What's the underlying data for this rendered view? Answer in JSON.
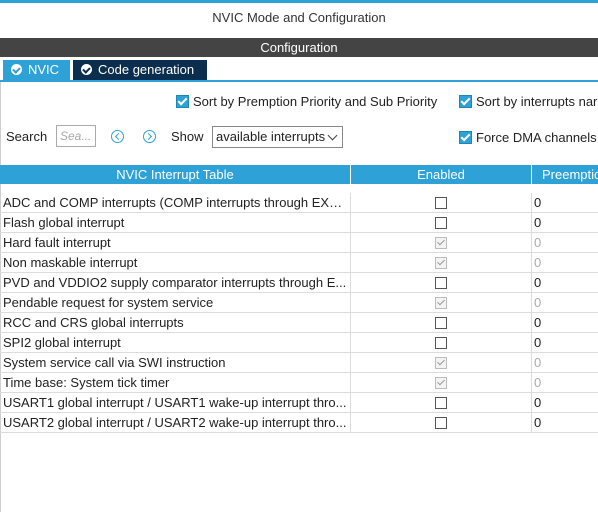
{
  "window": {
    "title": "NVIC Mode and Configuration"
  },
  "configuration_bar": "Configuration",
  "tabs": [
    {
      "label": "NVIC",
      "active": true
    },
    {
      "label": "Code generation",
      "active": false
    }
  ],
  "options": {
    "sort_premption": {
      "label": "Sort by Premption Priority and Sub Priority",
      "checked": true
    },
    "sort_interrupts": {
      "label": "Sort by interrupts nar",
      "checked": true
    },
    "force_dma": {
      "label": "Force DMA channels",
      "checked": true
    }
  },
  "search": {
    "label": "Search",
    "placeholder": "Sea..."
  },
  "show": {
    "label": "Show",
    "selected": "available interrupts"
  },
  "table": {
    "headers": [
      "NVIC Interrupt Table",
      "Enabled",
      "Preemptio"
    ],
    "rows": [
      {
        "name": "ADC and COMP interrupts (COMP interrupts through EXTI...",
        "enabled": false,
        "disabled": false,
        "preemption": "0"
      },
      {
        "name": "Flash global interrupt",
        "enabled": false,
        "disabled": false,
        "preemption": "0"
      },
      {
        "name": "Hard fault interrupt",
        "enabled": true,
        "disabled": true,
        "preemption": "0"
      },
      {
        "name": "Non maskable interrupt",
        "enabled": true,
        "disabled": true,
        "preemption": "0"
      },
      {
        "name": "PVD and VDDIO2 supply comparator interrupts through E...",
        "enabled": false,
        "disabled": false,
        "preemption": "0"
      },
      {
        "name": "Pendable request for system service",
        "enabled": true,
        "disabled": true,
        "preemption": "0"
      },
      {
        "name": "RCC and CRS global interrupts",
        "enabled": false,
        "disabled": false,
        "preemption": "0"
      },
      {
        "name": "SPI2 global interrupt",
        "enabled": false,
        "disabled": false,
        "preemption": "0"
      },
      {
        "name": "System service call via SWI instruction",
        "enabled": true,
        "disabled": true,
        "preemption": "0"
      },
      {
        "name": "Time base: System tick timer",
        "enabled": true,
        "disabled": true,
        "preemption": "0"
      },
      {
        "name": "USART1 global interrupt / USART1 wake-up interrupt thro...",
        "enabled": false,
        "disabled": false,
        "preemption": "0"
      },
      {
        "name": "USART2 global interrupt / USART2 wake-up interrupt thro...",
        "enabled": false,
        "disabled": false,
        "preemption": "0"
      }
    ]
  },
  "colors": {
    "accent": "#2ea2d6",
    "dark_tab": "#0b2d4e",
    "config_bar": "#444444"
  }
}
